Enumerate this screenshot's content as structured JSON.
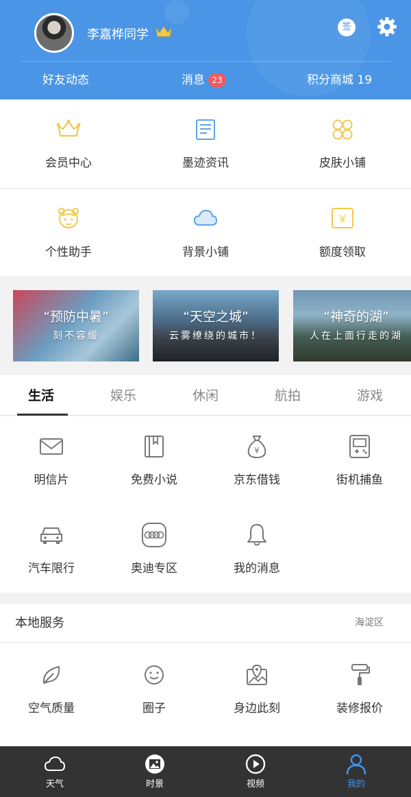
{
  "header": {
    "username": "李嘉桦同学",
    "sign_label": "签",
    "nav": {
      "friends": "好友动态",
      "messages": "消息",
      "message_count": "23",
      "points_mall": "积分商城 19"
    }
  },
  "features": {
    "row1": [
      {
        "label": "会员中心",
        "icon": "crown-icon"
      },
      {
        "label": "墨迹资讯",
        "icon": "news-icon"
      },
      {
        "label": "皮肤小铺",
        "icon": "skin-icon"
      }
    ],
    "row2": [
      {
        "label": "个性助手",
        "icon": "assistant-icon"
      },
      {
        "label": "背景小铺",
        "icon": "cloud-icon"
      },
      {
        "label": "额度领取",
        "icon": "quota-icon"
      }
    ]
  },
  "banners": [
    {
      "title": "“预防中暑”",
      "subtitle": "刻不容缓"
    },
    {
      "title": "“天空之城”",
      "subtitle": "云雾缭绕的城市！"
    },
    {
      "title": "“神奇的湖”",
      "subtitle": "人在上面行走的湖"
    }
  ],
  "tabs": [
    "生活",
    "娱乐",
    "休闲",
    "航拍",
    "游戏"
  ],
  "life": {
    "row1": [
      {
        "label": "明信片",
        "icon": "envelope-icon"
      },
      {
        "label": "免费小说",
        "icon": "book-icon"
      },
      {
        "label": "京东借钱",
        "icon": "money-bag-icon"
      },
      {
        "label": "街机捕鱼",
        "icon": "gamepad-icon"
      }
    ],
    "row2": [
      {
        "label": "汽车限行",
        "icon": "car-icon"
      },
      {
        "label": "奥迪专区",
        "icon": "audi-icon"
      },
      {
        "label": "我的消息",
        "icon": "bell-icon"
      }
    ]
  },
  "local": {
    "title": "本地服务",
    "area": "海淀区",
    "items": [
      {
        "label": "空气质量",
        "icon": "leaf-icon"
      },
      {
        "label": "圈子",
        "icon": "smile-icon"
      },
      {
        "label": "身边此刻",
        "icon": "map-pin-icon"
      },
      {
        "label": "装修报价",
        "icon": "paint-roller-icon"
      }
    ]
  },
  "bottom_nav": [
    {
      "label": "天气",
      "icon": "weather-cloud-icon"
    },
    {
      "label": "时景",
      "icon": "photo-icon"
    },
    {
      "label": "视频",
      "icon": "play-icon"
    },
    {
      "label": "我的",
      "icon": "person-icon",
      "active": true
    }
  ],
  "colors": {
    "header_bg": "#4a95e6",
    "accent_gold": "#f2c94c",
    "bottom_nav_bg": "#333333",
    "active_blue": "#3e96f0",
    "badge_red": "#f25b5b"
  }
}
